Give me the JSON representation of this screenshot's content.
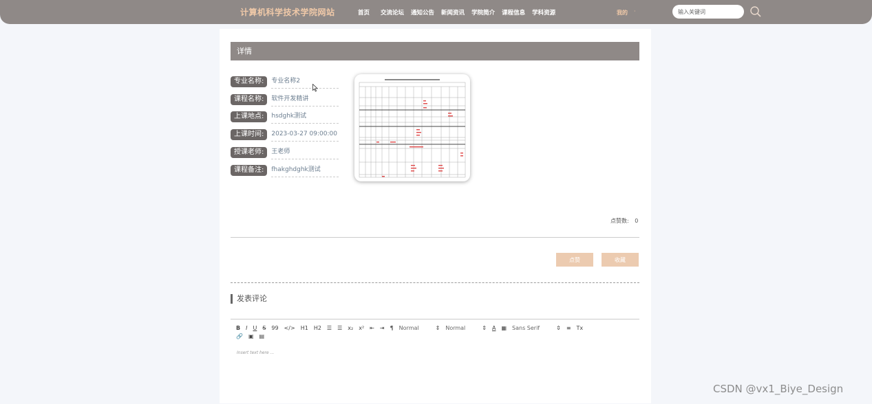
{
  "header": {
    "site_title": "计算机科学技术学院网站",
    "nav": [
      "首页",
      "交流论坛",
      "通知公告",
      "新闻资讯",
      "学院简介",
      "课程信息",
      "学科资源"
    ],
    "my_label": "我的",
    "my_caret": "·",
    "search_placeholder": "输入关键词"
  },
  "detail": {
    "header": "详情",
    "fields": [
      {
        "label": "专业名称:",
        "value": "专业名称2"
      },
      {
        "label": "课程名称:",
        "value": "软件开发精讲"
      },
      {
        "label": "上课地点:",
        "value": "hsdghk测试"
      },
      {
        "label": "上课时间:",
        "value": "2023-03-27 09:00:00"
      },
      {
        "label": "授课老师:",
        "value": "王老师"
      },
      {
        "label": "课程备注:",
        "value": "fhakghdghk测试"
      }
    ],
    "clicks_label": "点赞数:",
    "clicks_value": "0",
    "like_button": "点赞",
    "favorite_button": "收藏"
  },
  "comments": {
    "title": "发表评论",
    "toolbar_row1": [
      "B",
      "I",
      "U",
      "S",
      "99",
      "</>",
      "H1",
      "H2",
      "☰",
      "☰",
      "x₂",
      "x²",
      "⇤",
      "⇥",
      "¶"
    ],
    "toolbar_selects": [
      "Normal",
      "Normal"
    ],
    "toolbar_color": "A",
    "toolbar_font": "Sans Serif",
    "toolbar_row2": [
      "🔗",
      "▣",
      "▤"
    ],
    "editor_placeholder": "Insert text here ..."
  },
  "watermark": "CSDN @vx1_Biye_Design",
  "colors": {
    "topbar": "#8f8987",
    "accent": "#f0c9a8",
    "button": "#eccbb0",
    "label_bg": "#6b6665"
  }
}
